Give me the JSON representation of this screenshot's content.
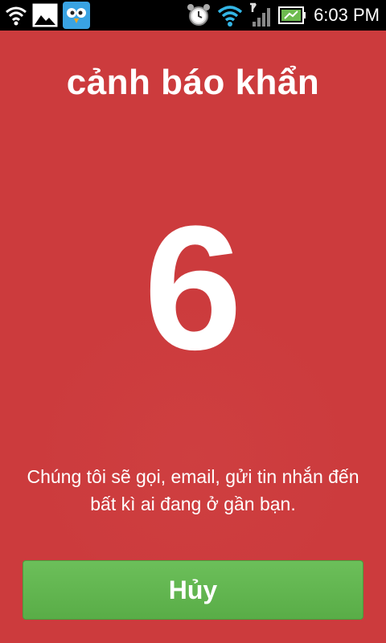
{
  "status_bar": {
    "time": "6:03 PM",
    "left_icons": [
      "wifi-icon",
      "gallery-notification-icon",
      "bird-app-icon"
    ],
    "right_icons": [
      "alarm-clock-icon",
      "wifi-icon",
      "signal-icon",
      "battery-icon"
    ]
  },
  "alert": {
    "title": "cảnh báo khẩn",
    "countdown": "6",
    "message": "Chúng tôi sẽ gọi, email, gửi tin nhắn đến bất kì ai đang ở gần bạn.",
    "cancel_label": "Hủy"
  },
  "colors": {
    "background": "#cc3b3d",
    "button": "#5fb44e",
    "text": "#ffffff",
    "status_bar": "#000000"
  }
}
